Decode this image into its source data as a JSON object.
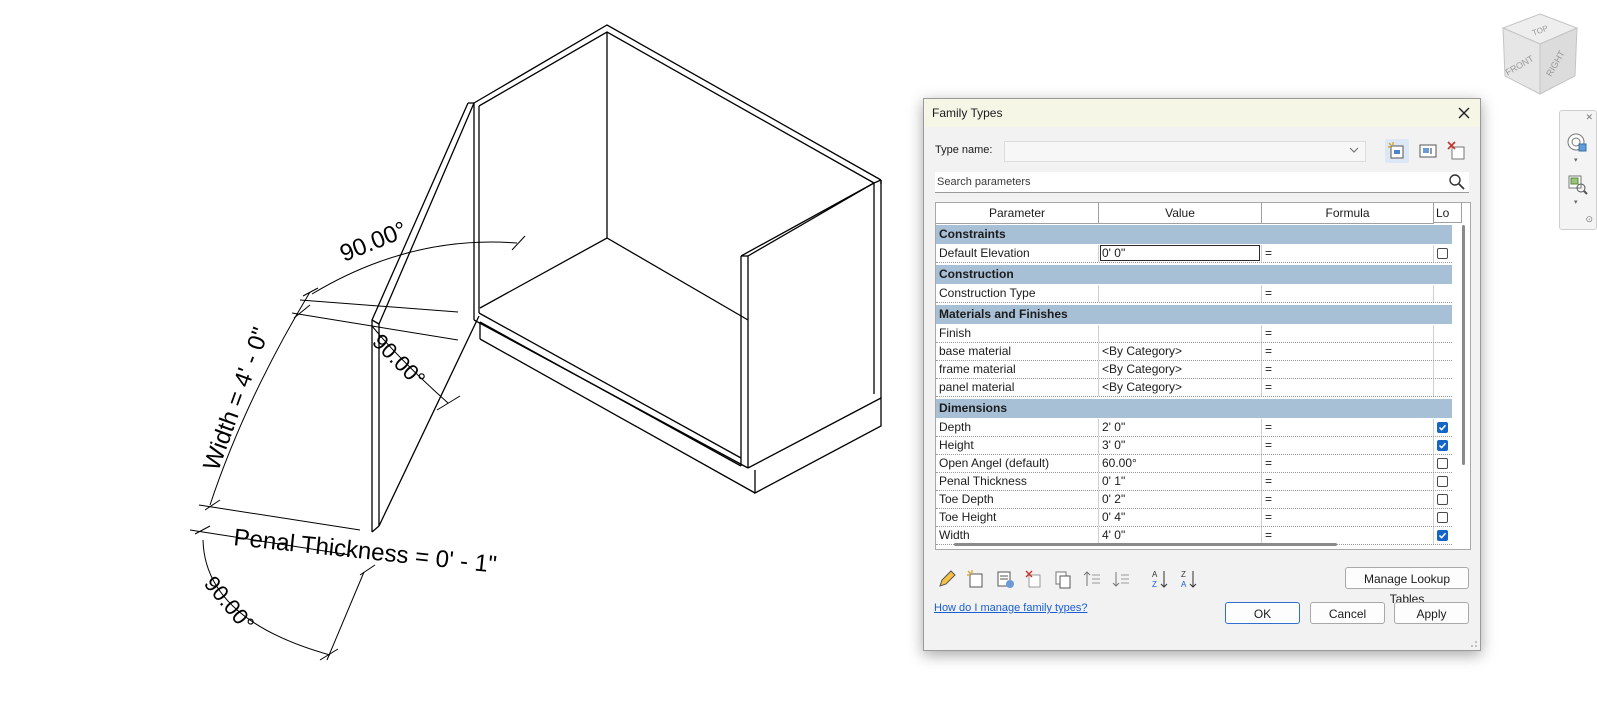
{
  "drawing": {
    "dim_angle_top": "90.00°",
    "dim_angle_mid": "90.00°",
    "dim_angle_bottom": "90.00°",
    "dim_width": "Width = 4' - 0\"",
    "dim_penal_thickness": "Penal Thickness = 0' - 1\""
  },
  "viewcube": {
    "top": "TOP",
    "front": "FRONT",
    "right": "RIGHT"
  },
  "dialog": {
    "title": "Family Types",
    "type_name_label": "Type name:",
    "type_name_value": "",
    "search_placeholder": "Search parameters",
    "columns": [
      "Parameter",
      "Value",
      "Formula",
      "Lo"
    ],
    "groups": [
      {
        "name": "Constraints",
        "rows": [
          {
            "param": "Default Elevation",
            "value": "0'  0\"",
            "formula": "=",
            "locked": false,
            "editing": true
          }
        ]
      },
      {
        "name": "Construction",
        "rows": [
          {
            "param": "Construction Type",
            "value": "",
            "formula": "=",
            "locked": null
          }
        ]
      },
      {
        "name": "Materials and Finishes",
        "rows": [
          {
            "param": "Finish",
            "value": "",
            "formula": "=",
            "locked": null
          },
          {
            "param": "base material",
            "value": "<By Category>",
            "formula": "=",
            "locked": null
          },
          {
            "param": "frame material",
            "value": "<By Category>",
            "formula": "=",
            "locked": null
          },
          {
            "param": "panel material",
            "value": "<By Category>",
            "formula": "=",
            "locked": null
          }
        ]
      },
      {
        "name": "Dimensions",
        "rows": [
          {
            "param": "Depth",
            "value": "2'  0\"",
            "formula": "=",
            "locked": true
          },
          {
            "param": "Height",
            "value": "3'  0\"",
            "formula": "=",
            "locked": true
          },
          {
            "param": "Open Angel (default)",
            "value": "60.00°",
            "formula": "=",
            "locked": false
          },
          {
            "param": "Penal Thickness",
            "value": "0'  1\"",
            "formula": "=",
            "locked": false
          },
          {
            "param": "Toe Depth",
            "value": "0'  2\"",
            "formula": "=",
            "locked": false
          },
          {
            "param": "Toe Height",
            "value": "0'  4\"",
            "formula": "=",
            "locked": false
          },
          {
            "param": "Width",
            "value": "4'  0\"",
            "formula": "=",
            "locked": true
          }
        ]
      }
    ],
    "manage_lookup_label": "Manage Lookup Tables",
    "help_link": "How do I manage family types?",
    "ok_label": "OK",
    "cancel_label": "Cancel",
    "apply_label": "Apply",
    "accent_color": "#1565c8",
    "group_header_color": "#a8c0d6"
  }
}
